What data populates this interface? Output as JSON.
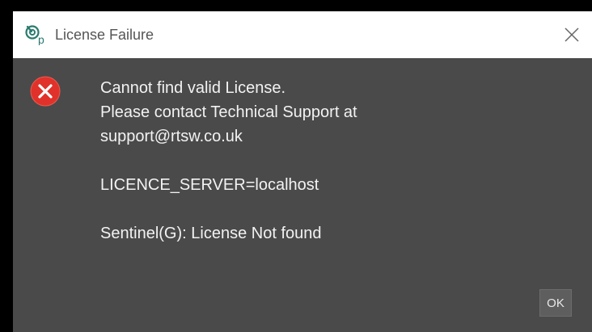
{
  "window": {
    "title": "License Failure",
    "app_icon": "rtsw-app-icon",
    "close_icon": "close-icon"
  },
  "dialog": {
    "icon": "error-icon",
    "icon_color": "#e0322a",
    "message_lines": [
      "Cannot find valid License.",
      "Please contact Technical Support at",
      "support@rtsw.co.uk",
      "LICENCE_SERVER=localhost",
      "Sentinel(G): License Not found"
    ],
    "ok_label": "OK"
  },
  "colors": {
    "titlebar_bg": "#ffffff",
    "dialog_bg": "#4a4a4a",
    "text": "#f2f2f2",
    "button_bg": "#5e5e5e"
  }
}
